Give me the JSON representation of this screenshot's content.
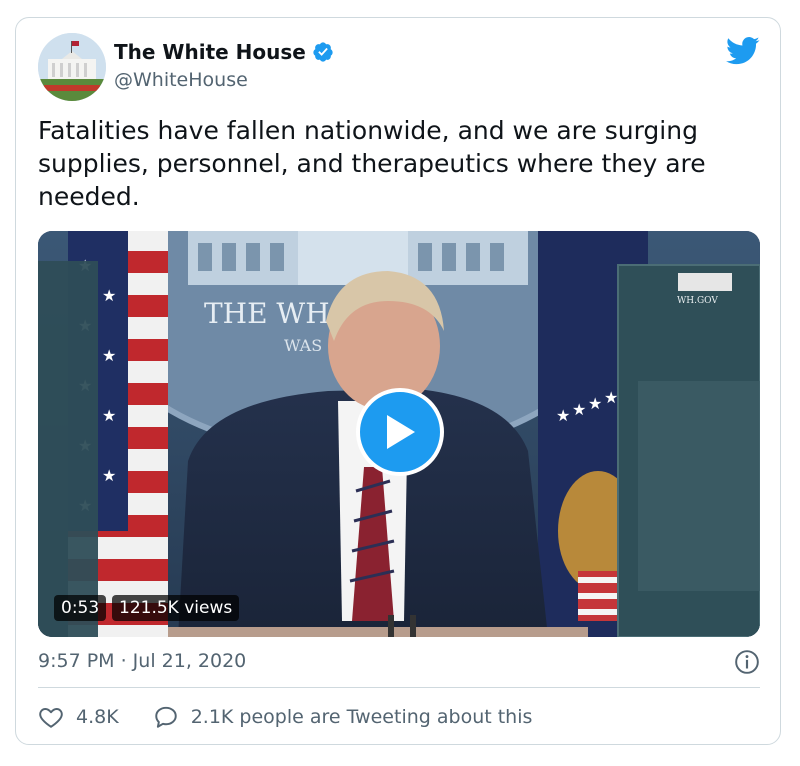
{
  "author": {
    "name": "The White House",
    "handle": "@WhiteHouse",
    "verified": true
  },
  "tweet": {
    "text": "Fatalities have fallen nationwide, and we are surging supplies, personnel, and therapeutics where they are needed."
  },
  "media": {
    "duration": "0:53",
    "views": "121.5K views",
    "backdrop_title": "THE WH      OUSE",
    "backdrop_subtitle": "WAS",
    "screen_label": "WH.GOV"
  },
  "footer": {
    "timestamp": "9:57 PM · Jul 21, 2020",
    "likes": "4.8K",
    "tweeting": "2.1K people are Tweeting about this"
  },
  "colors": {
    "accent": "#1d9bf0",
    "text_primary": "#0f1419",
    "text_secondary": "#536471",
    "border": "#cfd9de"
  },
  "icons": [
    "verified-badge-icon",
    "twitter-bird-icon",
    "play-icon",
    "info-icon",
    "heart-icon",
    "comment-icon"
  ]
}
